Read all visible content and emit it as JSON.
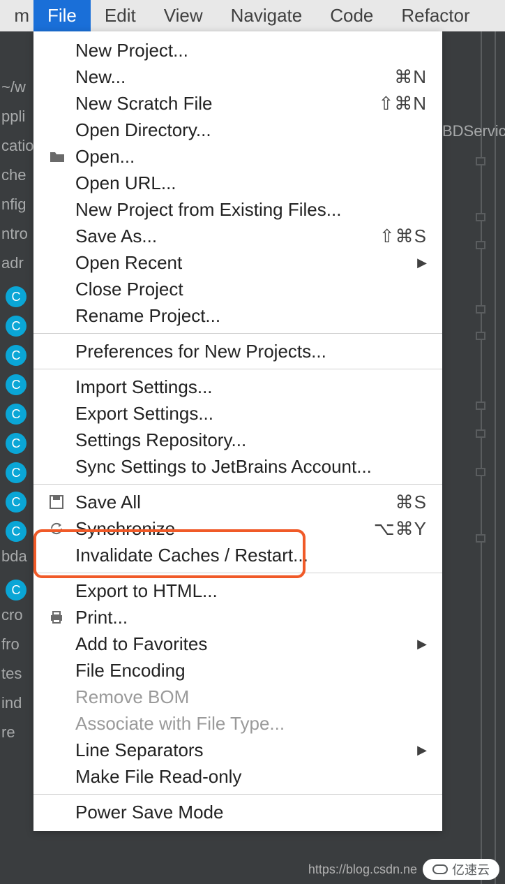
{
  "menubar": {
    "prefix": "m",
    "items": [
      "File",
      "Edit",
      "View",
      "Navigate",
      "Code",
      "Refactor"
    ],
    "active_index": 0
  },
  "background_tab": "BDServic",
  "sidebar_fragments": {
    "path": "~/w",
    "lines": [
      "ppli",
      "catio",
      "che",
      "nfig",
      "ntro",
      " adr"
    ],
    "c_count_a": 9,
    "mid": [
      "bda"
    ],
    "c_count_b": 1,
    "tail": [
      "cro",
      "fro",
      "tes",
      "ind",
      "re"
    ]
  },
  "file_menu": {
    "groups": [
      [
        {
          "label": "New Project...",
          "icon": "",
          "shortcut": "",
          "submenu": false
        },
        {
          "label": "New...",
          "icon": "",
          "shortcut": "⌘N",
          "submenu": false
        },
        {
          "label": "New Scratch File",
          "icon": "",
          "shortcut": "⇧⌘N",
          "submenu": false
        },
        {
          "label": "Open Directory...",
          "icon": "",
          "shortcut": "",
          "submenu": false
        },
        {
          "label": "Open...",
          "icon": "folder",
          "shortcut": "",
          "submenu": false
        },
        {
          "label": "Open URL...",
          "icon": "",
          "shortcut": "",
          "submenu": false
        },
        {
          "label": "New Project from Existing Files...",
          "icon": "",
          "shortcut": "",
          "submenu": false
        },
        {
          "label": "Save As...",
          "icon": "",
          "shortcut": "⇧⌘S",
          "submenu": false
        },
        {
          "label": "Open Recent",
          "icon": "",
          "shortcut": "",
          "submenu": true
        },
        {
          "label": "Close Project",
          "icon": "",
          "shortcut": "",
          "submenu": false
        },
        {
          "label": "Rename Project...",
          "icon": "",
          "shortcut": "",
          "submenu": false
        }
      ],
      [
        {
          "label": "Preferences for New Projects...",
          "icon": "",
          "shortcut": "",
          "submenu": false
        }
      ],
      [
        {
          "label": "Import Settings...",
          "icon": "",
          "shortcut": "",
          "submenu": false
        },
        {
          "label": "Export Settings...",
          "icon": "",
          "shortcut": "",
          "submenu": false
        },
        {
          "label": "Settings Repository...",
          "icon": "",
          "shortcut": "",
          "submenu": false
        },
        {
          "label": "Sync Settings to JetBrains Account...",
          "icon": "",
          "shortcut": "",
          "submenu": false
        }
      ],
      [
        {
          "label": "Save All",
          "icon": "save",
          "shortcut": "⌘S",
          "submenu": false
        },
        {
          "label": "Synchronize",
          "icon": "sync",
          "shortcut": "⌥⌘Y",
          "submenu": false
        },
        {
          "label": "Invalidate Caches / Restart...",
          "icon": "",
          "shortcut": "",
          "submenu": false,
          "highlight": true
        }
      ],
      [
        {
          "label": "Export to HTML...",
          "icon": "",
          "shortcut": "",
          "submenu": false
        },
        {
          "label": "Print...",
          "icon": "print",
          "shortcut": "",
          "submenu": false
        },
        {
          "label": "Add to Favorites",
          "icon": "",
          "shortcut": "",
          "submenu": true
        },
        {
          "label": "File Encoding",
          "icon": "",
          "shortcut": "",
          "submenu": false
        },
        {
          "label": "Remove BOM",
          "icon": "",
          "shortcut": "",
          "submenu": false,
          "disabled": true
        },
        {
          "label": "Associate with File Type...",
          "icon": "",
          "shortcut": "",
          "submenu": false,
          "disabled": true
        },
        {
          "label": "Line Separators",
          "icon": "",
          "shortcut": "",
          "submenu": true
        },
        {
          "label": "Make File Read-only",
          "icon": "",
          "shortcut": "",
          "submenu": false
        }
      ],
      [
        {
          "label": "Power Save Mode",
          "icon": "",
          "shortcut": "",
          "submenu": false
        }
      ]
    ]
  },
  "watermark": {
    "url": "https://blog.csdn.ne",
    "brand": "亿速云"
  }
}
